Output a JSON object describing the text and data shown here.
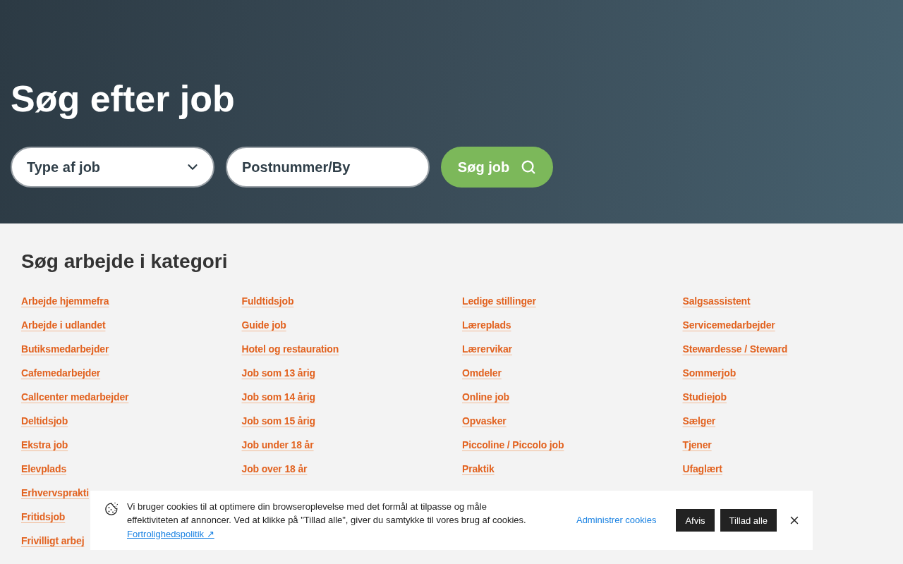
{
  "hero": {
    "title": "Søg efter job",
    "job_type_select": {
      "placeholder": "Type af job"
    },
    "location_field": {
      "placeholder": "Postnummer/By"
    },
    "search_button": {
      "label": "Søg job"
    }
  },
  "categories": {
    "heading": "Søg arbejde i kategori",
    "columns": [
      [
        "Arbejde hjemmefra",
        "Arbejde i udlandet",
        "Butiksmedarbejder",
        "Cafemedarbejder",
        "Callcenter medarbejder",
        "Deltidsjob",
        "Ekstra job",
        "Elevplads",
        "Erhvervsprakti",
        "Fritidsjob",
        "Frivilligt arbej"
      ],
      [
        "Fuldtidsjob",
        "Guide job",
        "Hotel og restauration",
        "Job som 13 årig",
        "Job som 14 årig",
        "Job som 15 årig",
        "Job under 18 år",
        "Job over 18 år"
      ],
      [
        "Ledige stillinger",
        "Læreplads",
        "Lærervikar",
        "Omdeler",
        "Online job",
        "Opvasker",
        "Piccoline / Piccolo job",
        "Praktik"
      ],
      [
        "Salgsassistent",
        "Servicemedarbejder",
        "Stewardesse / Steward",
        "Sommerjob",
        "Studiejob",
        "Sælger",
        "Tjener",
        "Ufaglært"
      ]
    ]
  },
  "cookie_banner": {
    "message": "Vi bruger cookies til at optimere din browseroplevelse med det formål at tilpasse og måle effektiviteten af annoncer. Ved at klikke på \"Tillad alle\", giver du samtykke til vores brug af cookies.",
    "privacy_link": "Fortrolighedspolitik ↗",
    "manage_link": "Administrer cookies",
    "buttons": [
      "Afvis",
      "Tillad alle"
    ]
  }
}
